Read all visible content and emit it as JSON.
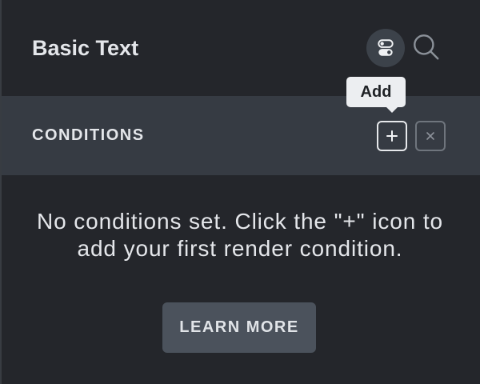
{
  "header": {
    "title": "Basic Text"
  },
  "tooltip": {
    "label": "Add"
  },
  "conditions": {
    "heading": "CONDITIONS"
  },
  "empty_state": {
    "lines": [
      "No conditions set. Click the \"+\" icon to",
      "add your first render condition."
    ],
    "button_label": "LEARN MORE"
  },
  "icons": {
    "toggle": "toggle-icon",
    "search": "search-icon",
    "add": "plus-icon",
    "close": "close-icon"
  },
  "colors": {
    "background": "#24262b",
    "edge": "#383c42",
    "section_bar": "#363b43",
    "text": "#e4e6ea",
    "icon_active_bg": "#3c424a",
    "tooltip_bg": "#eceef1",
    "tooltip_text": "#1e2125",
    "bright_border": "#e6e8eb",
    "muted_border": "#6f757d",
    "button_bg": "#4b525c",
    "button_text": "#e1e4e8"
  }
}
